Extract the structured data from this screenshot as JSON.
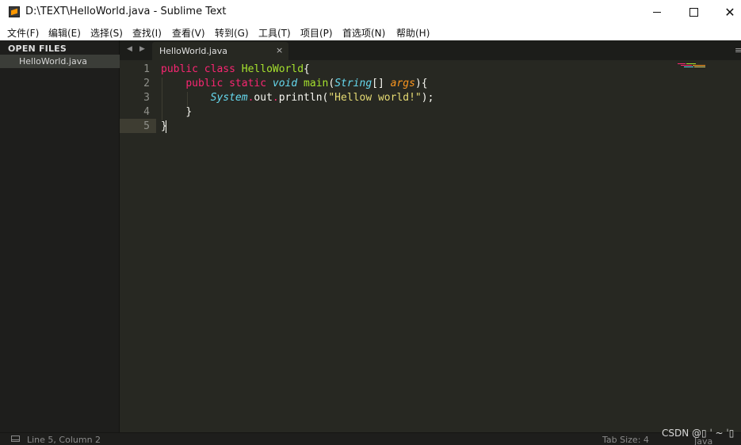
{
  "window": {
    "title": "D:\\TEXT\\HelloWorld.java - Sublime Text"
  },
  "menu": [
    "文件(F)",
    "编辑(E)",
    "选择(S)",
    "查找(I)",
    "查看(V)",
    "转到(G)",
    "工具(T)",
    "项目(P)",
    "首选项(N)",
    "帮助(H)"
  ],
  "sidebar": {
    "header": "OPEN FILES",
    "files": [
      "HelloWorld.java"
    ]
  },
  "tabs": [
    {
      "label": "HelloWorld.java",
      "close": "×"
    }
  ],
  "tabbar": {
    "prev": "◀",
    "next": "▶",
    "menu": "≡"
  },
  "editor": {
    "line_numbers": [
      "1",
      "2",
      "3",
      "4",
      "5"
    ],
    "lines": [
      [
        {
          "t": "public ",
          "c": "kw"
        },
        {
          "t": "class ",
          "c": "kw"
        },
        {
          "t": "HelloWorld",
          "c": "cls"
        },
        {
          "t": "{",
          "c": "plain"
        }
      ],
      [
        {
          "t": "    ",
          "c": "plain"
        },
        {
          "t": "public ",
          "c": "kw"
        },
        {
          "t": "static ",
          "c": "kw"
        },
        {
          "t": "void ",
          "c": "typ"
        },
        {
          "t": "main",
          "c": "fn"
        },
        {
          "t": "(",
          "c": "plain"
        },
        {
          "t": "String",
          "c": "typ"
        },
        {
          "t": "[] ",
          "c": "plain"
        },
        {
          "t": "args",
          "c": "param"
        },
        {
          "t": "){",
          "c": "plain"
        }
      ],
      [
        {
          "t": "        ",
          "c": "plain"
        },
        {
          "t": "System",
          "c": "typ"
        },
        {
          "t": ".",
          "c": "kw"
        },
        {
          "t": "out",
          "c": "plain"
        },
        {
          "t": ".",
          "c": "kw"
        },
        {
          "t": "println",
          "c": "plain"
        },
        {
          "t": "(",
          "c": "plain"
        },
        {
          "t": "\"Hellow world!\"",
          "c": "str"
        },
        {
          "t": ");",
          "c": "plain"
        }
      ],
      [
        {
          "t": "    ",
          "c": "plain"
        },
        {
          "t": "}",
          "c": "plain"
        }
      ],
      [
        {
          "t": "}",
          "c": "plain"
        }
      ]
    ]
  },
  "status": {
    "position": "Line 5, Column 2",
    "tab_size": "Tab Size: 4",
    "syntax": "Java"
  },
  "watermark": "CSDN @▯ ˈ ~ ˈ▯",
  "colors": {
    "background": "#272822",
    "keyword": "#f92672",
    "class_name": "#a6e22e",
    "type": "#66d9ef",
    "parameter": "#fd971f",
    "string": "#e6db74",
    "text": "#f8f8f2"
  }
}
